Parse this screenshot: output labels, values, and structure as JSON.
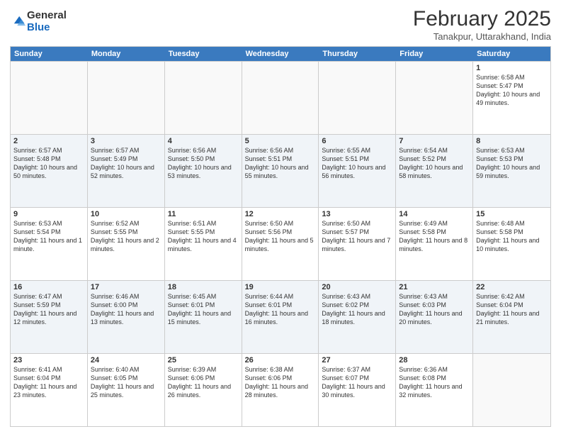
{
  "logo": {
    "general": "General",
    "blue": "Blue"
  },
  "header": {
    "month": "February 2025",
    "location": "Tanakpur, Uttarakhand, India"
  },
  "weekdays": [
    "Sunday",
    "Monday",
    "Tuesday",
    "Wednesday",
    "Thursday",
    "Friday",
    "Saturday"
  ],
  "weeks": [
    [
      {
        "day": "",
        "info": ""
      },
      {
        "day": "",
        "info": ""
      },
      {
        "day": "",
        "info": ""
      },
      {
        "day": "",
        "info": ""
      },
      {
        "day": "",
        "info": ""
      },
      {
        "day": "",
        "info": ""
      },
      {
        "day": "1",
        "info": "Sunrise: 6:58 AM\nSunset: 5:47 PM\nDaylight: 10 hours and 49 minutes."
      }
    ],
    [
      {
        "day": "2",
        "info": "Sunrise: 6:57 AM\nSunset: 5:48 PM\nDaylight: 10 hours and 50 minutes."
      },
      {
        "day": "3",
        "info": "Sunrise: 6:57 AM\nSunset: 5:49 PM\nDaylight: 10 hours and 52 minutes."
      },
      {
        "day": "4",
        "info": "Sunrise: 6:56 AM\nSunset: 5:50 PM\nDaylight: 10 hours and 53 minutes."
      },
      {
        "day": "5",
        "info": "Sunrise: 6:56 AM\nSunset: 5:51 PM\nDaylight: 10 hours and 55 minutes."
      },
      {
        "day": "6",
        "info": "Sunrise: 6:55 AM\nSunset: 5:51 PM\nDaylight: 10 hours and 56 minutes."
      },
      {
        "day": "7",
        "info": "Sunrise: 6:54 AM\nSunset: 5:52 PM\nDaylight: 10 hours and 58 minutes."
      },
      {
        "day": "8",
        "info": "Sunrise: 6:53 AM\nSunset: 5:53 PM\nDaylight: 10 hours and 59 minutes."
      }
    ],
    [
      {
        "day": "9",
        "info": "Sunrise: 6:53 AM\nSunset: 5:54 PM\nDaylight: 11 hours and 1 minute."
      },
      {
        "day": "10",
        "info": "Sunrise: 6:52 AM\nSunset: 5:55 PM\nDaylight: 11 hours and 2 minutes."
      },
      {
        "day": "11",
        "info": "Sunrise: 6:51 AM\nSunset: 5:55 PM\nDaylight: 11 hours and 4 minutes."
      },
      {
        "day": "12",
        "info": "Sunrise: 6:50 AM\nSunset: 5:56 PM\nDaylight: 11 hours and 5 minutes."
      },
      {
        "day": "13",
        "info": "Sunrise: 6:50 AM\nSunset: 5:57 PM\nDaylight: 11 hours and 7 minutes."
      },
      {
        "day": "14",
        "info": "Sunrise: 6:49 AM\nSunset: 5:58 PM\nDaylight: 11 hours and 8 minutes."
      },
      {
        "day": "15",
        "info": "Sunrise: 6:48 AM\nSunset: 5:58 PM\nDaylight: 11 hours and 10 minutes."
      }
    ],
    [
      {
        "day": "16",
        "info": "Sunrise: 6:47 AM\nSunset: 5:59 PM\nDaylight: 11 hours and 12 minutes."
      },
      {
        "day": "17",
        "info": "Sunrise: 6:46 AM\nSunset: 6:00 PM\nDaylight: 11 hours and 13 minutes."
      },
      {
        "day": "18",
        "info": "Sunrise: 6:45 AM\nSunset: 6:01 PM\nDaylight: 11 hours and 15 minutes."
      },
      {
        "day": "19",
        "info": "Sunrise: 6:44 AM\nSunset: 6:01 PM\nDaylight: 11 hours and 16 minutes."
      },
      {
        "day": "20",
        "info": "Sunrise: 6:43 AM\nSunset: 6:02 PM\nDaylight: 11 hours and 18 minutes."
      },
      {
        "day": "21",
        "info": "Sunrise: 6:43 AM\nSunset: 6:03 PM\nDaylight: 11 hours and 20 minutes."
      },
      {
        "day": "22",
        "info": "Sunrise: 6:42 AM\nSunset: 6:04 PM\nDaylight: 11 hours and 21 minutes."
      }
    ],
    [
      {
        "day": "23",
        "info": "Sunrise: 6:41 AM\nSunset: 6:04 PM\nDaylight: 11 hours and 23 minutes."
      },
      {
        "day": "24",
        "info": "Sunrise: 6:40 AM\nSunset: 6:05 PM\nDaylight: 11 hours and 25 minutes."
      },
      {
        "day": "25",
        "info": "Sunrise: 6:39 AM\nSunset: 6:06 PM\nDaylight: 11 hours and 26 minutes."
      },
      {
        "day": "26",
        "info": "Sunrise: 6:38 AM\nSunset: 6:06 PM\nDaylight: 11 hours and 28 minutes."
      },
      {
        "day": "27",
        "info": "Sunrise: 6:37 AM\nSunset: 6:07 PM\nDaylight: 11 hours and 30 minutes."
      },
      {
        "day": "28",
        "info": "Sunrise: 6:36 AM\nSunset: 6:08 PM\nDaylight: 11 hours and 32 minutes."
      },
      {
        "day": "",
        "info": ""
      }
    ]
  ]
}
